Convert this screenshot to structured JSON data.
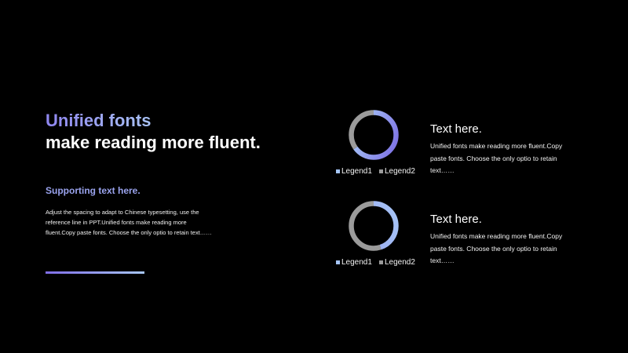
{
  "heading": {
    "accent": "Unified fonts",
    "main": "make reading more fluent."
  },
  "supporting_title": "Supporting text here.",
  "supporting_body": "Adjust the spacing to adapt to Chinese typesetting, use the reference line in PPT.Unified fonts make reading more fluent.Copy paste fonts. Choose the only optio to retain text……",
  "colors": {
    "background": "#000000",
    "accent_purple": "#8f86f0",
    "accent_blue": "#a9c3f6",
    "legend1": "#a6c5f7",
    "legend2": "#9b9b9b"
  },
  "chart_data": [
    {
      "type": "pie",
      "donut": true,
      "categories": [
        "Legend1",
        "Legend2"
      ],
      "values": [
        65,
        35
      ],
      "legend": [
        "Legend1",
        "Legend2"
      ],
      "legend_position": "bottom"
    },
    {
      "type": "pie",
      "donut": true,
      "categories": [
        "Legend1",
        "Legend2"
      ],
      "values": [
        45,
        55
      ],
      "legend": [
        "Legend1",
        "Legend2"
      ],
      "legend_position": "bottom"
    }
  ],
  "blocks": [
    {
      "title": "Text here.",
      "text": "Unified fonts make reading more fluent.Copy paste fonts. Choose the only optio to retain text……"
    },
    {
      "title": "Text here.",
      "text": "Unified fonts make reading more fluent.Copy paste fonts. Choose the only optio to retain text……"
    }
  ]
}
